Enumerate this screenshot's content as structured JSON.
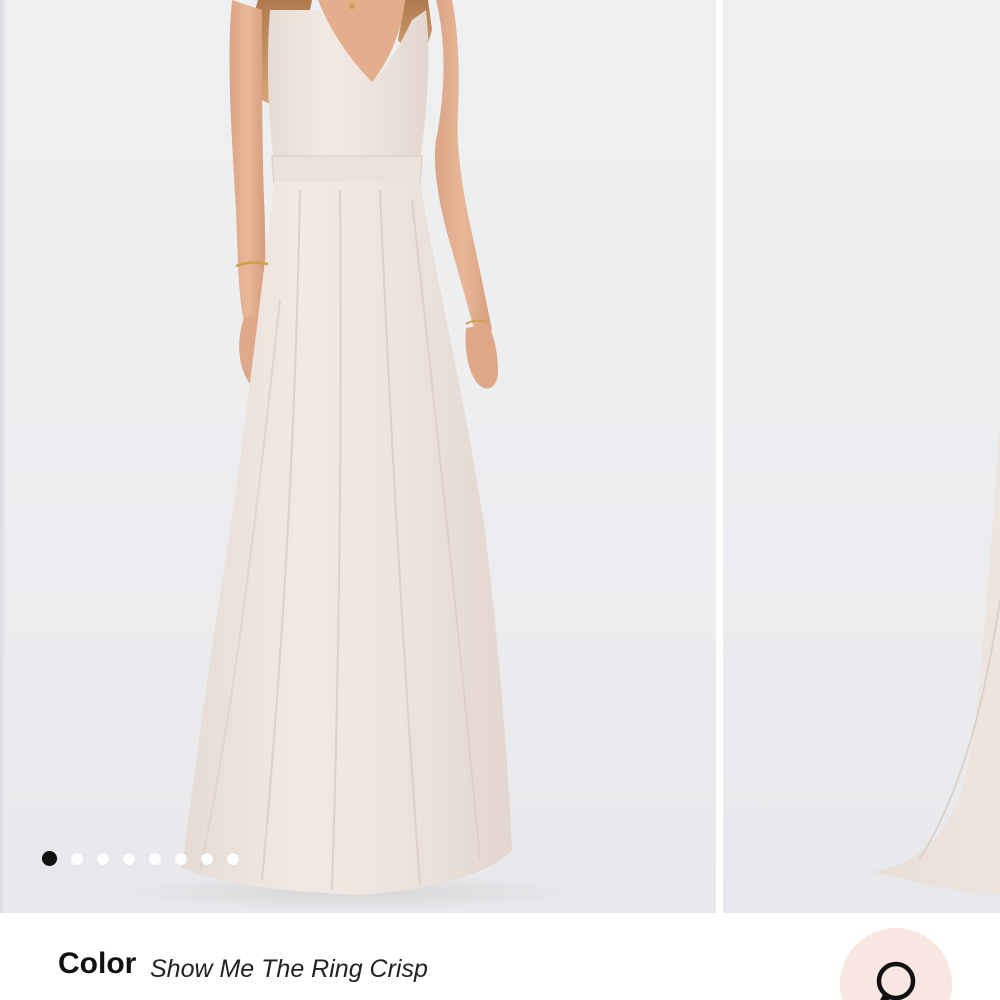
{
  "gallery": {
    "slide_count": 8,
    "active_index": 0,
    "image_subject": "model-wearing-long-blush-gown",
    "colors": {
      "background": "#eceef0",
      "dress": "#efe5df",
      "active_dot": "#111111",
      "inactive_dot": "#ffffff"
    }
  },
  "product": {
    "color_label": "Color",
    "color_value": "Show Me The Ring Crisp"
  },
  "chat": {
    "icon": "chat-bubble-icon",
    "accent": "#f8e6e2"
  }
}
